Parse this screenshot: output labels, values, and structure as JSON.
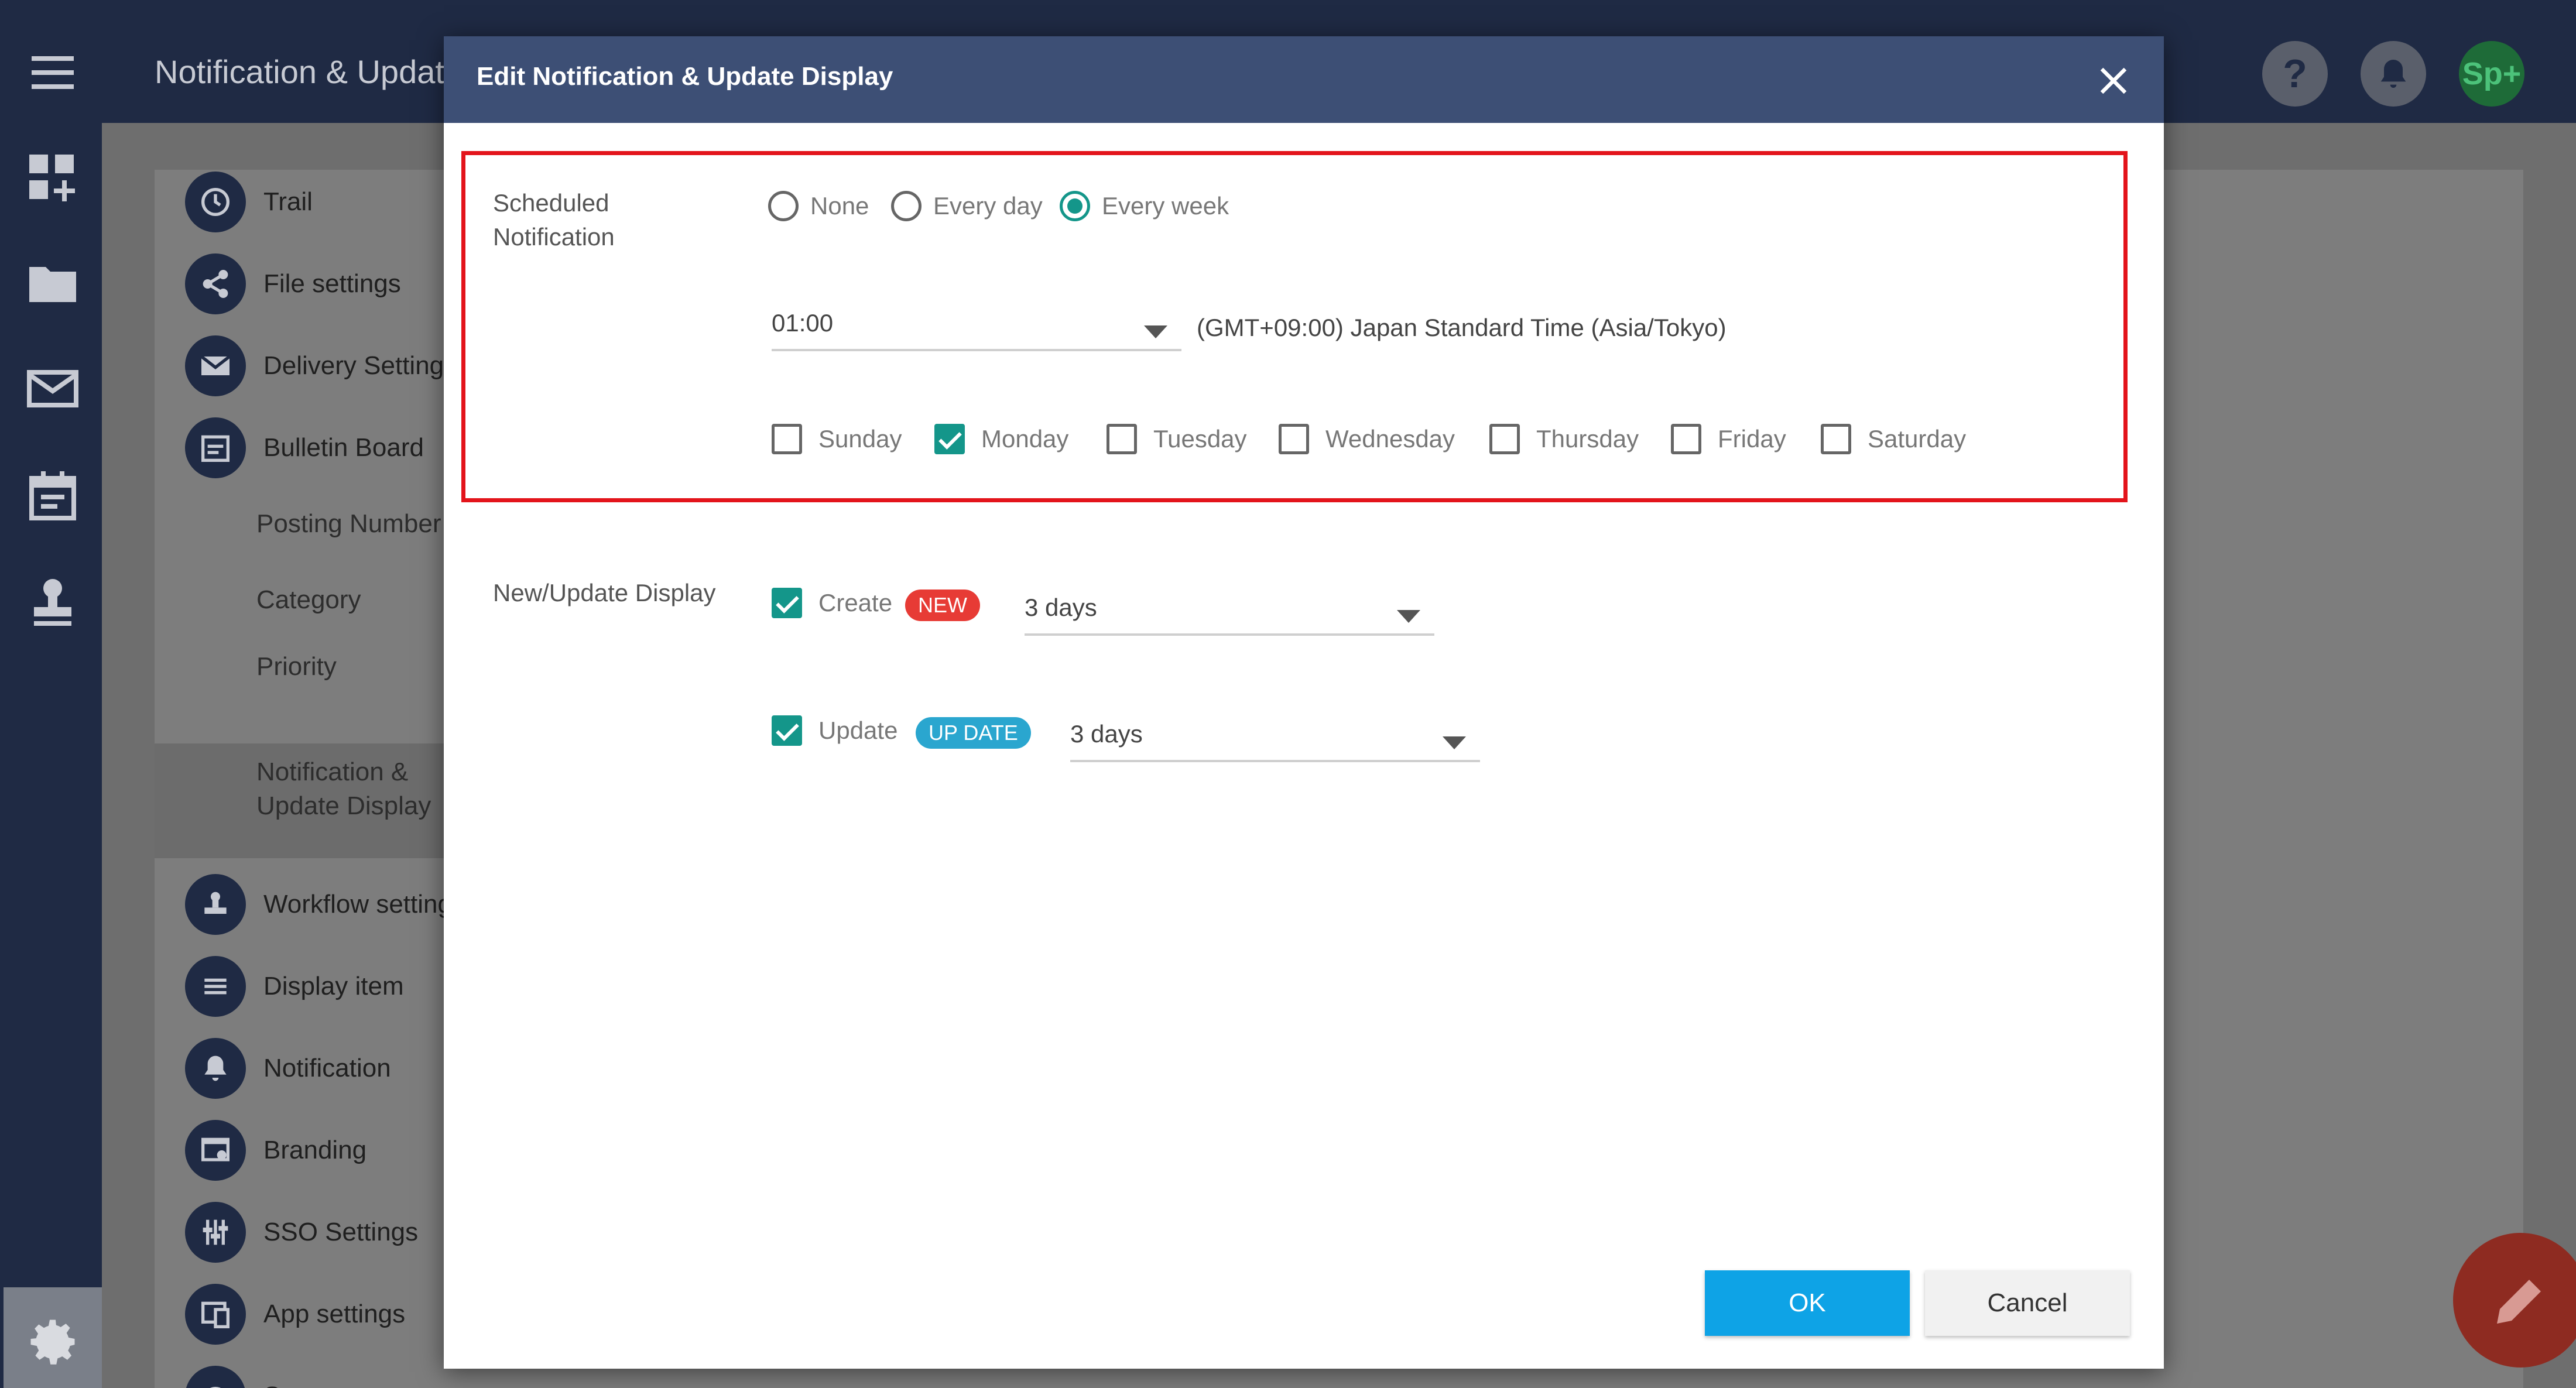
{
  "topbar": {
    "title": "Notification & Update Display",
    "help_glyph": "?",
    "avatar_initials": "Sp+"
  },
  "settings_menu": {
    "items": [
      {
        "label": "Trail",
        "icon": "clock-icon"
      },
      {
        "label": "File settings",
        "icon": "share-icon"
      },
      {
        "label": "Delivery Settings",
        "icon": "mail-icon"
      },
      {
        "label": "Bulletin Board",
        "icon": "calendar-icon"
      }
    ],
    "sub_items": [
      "Posting Number",
      "Category",
      "Priority",
      "Notification & Update Display"
    ],
    "items_after": [
      {
        "label": "Workflow settings",
        "icon": "stamp-icon"
      },
      {
        "label": "Display item",
        "icon": "list-icon"
      },
      {
        "label": "Notification",
        "icon": "bell-icon"
      },
      {
        "label": "Branding",
        "icon": "branding-icon"
      },
      {
        "label": "SSO Settings",
        "icon": "sliders-icon"
      },
      {
        "label": "App settings",
        "icon": "app-icon"
      },
      {
        "label": "Support",
        "icon": "support-icon"
      }
    ]
  },
  "dialog": {
    "title": "Edit Notification & Update Display",
    "scheduled": {
      "label": "Scheduled Notification",
      "options": [
        "None",
        "Every day",
        "Every week"
      ],
      "selected": "Every week",
      "time": "01:00",
      "timezone": "(GMT+09:00) Japan Standard Time (Asia/Tokyo)",
      "days": [
        {
          "label": "Sunday",
          "checked": false
        },
        {
          "label": "Monday",
          "checked": true
        },
        {
          "label": "Tuesday",
          "checked": false
        },
        {
          "label": "Wednesday",
          "checked": false
        },
        {
          "label": "Thursday",
          "checked": false
        },
        {
          "label": "Friday",
          "checked": false
        },
        {
          "label": "Saturday",
          "checked": false
        }
      ]
    },
    "display": {
      "label": "New/Update Display",
      "create": {
        "label": "Create",
        "checked": true,
        "badge": "NEW",
        "duration": "3 days"
      },
      "update": {
        "label": "Update",
        "checked": true,
        "badge": "UP DATE",
        "duration": "3 days"
      }
    },
    "buttons": {
      "ok": "OK",
      "cancel": "Cancel"
    }
  },
  "colors": {
    "accent_teal": "#14968a",
    "ok_blue": "#0ea3e6",
    "highlight_red": "#e3141b",
    "badge_new": "#e73b35",
    "badge_update": "#2aa6cf",
    "header_navy": "#3d4f75"
  }
}
